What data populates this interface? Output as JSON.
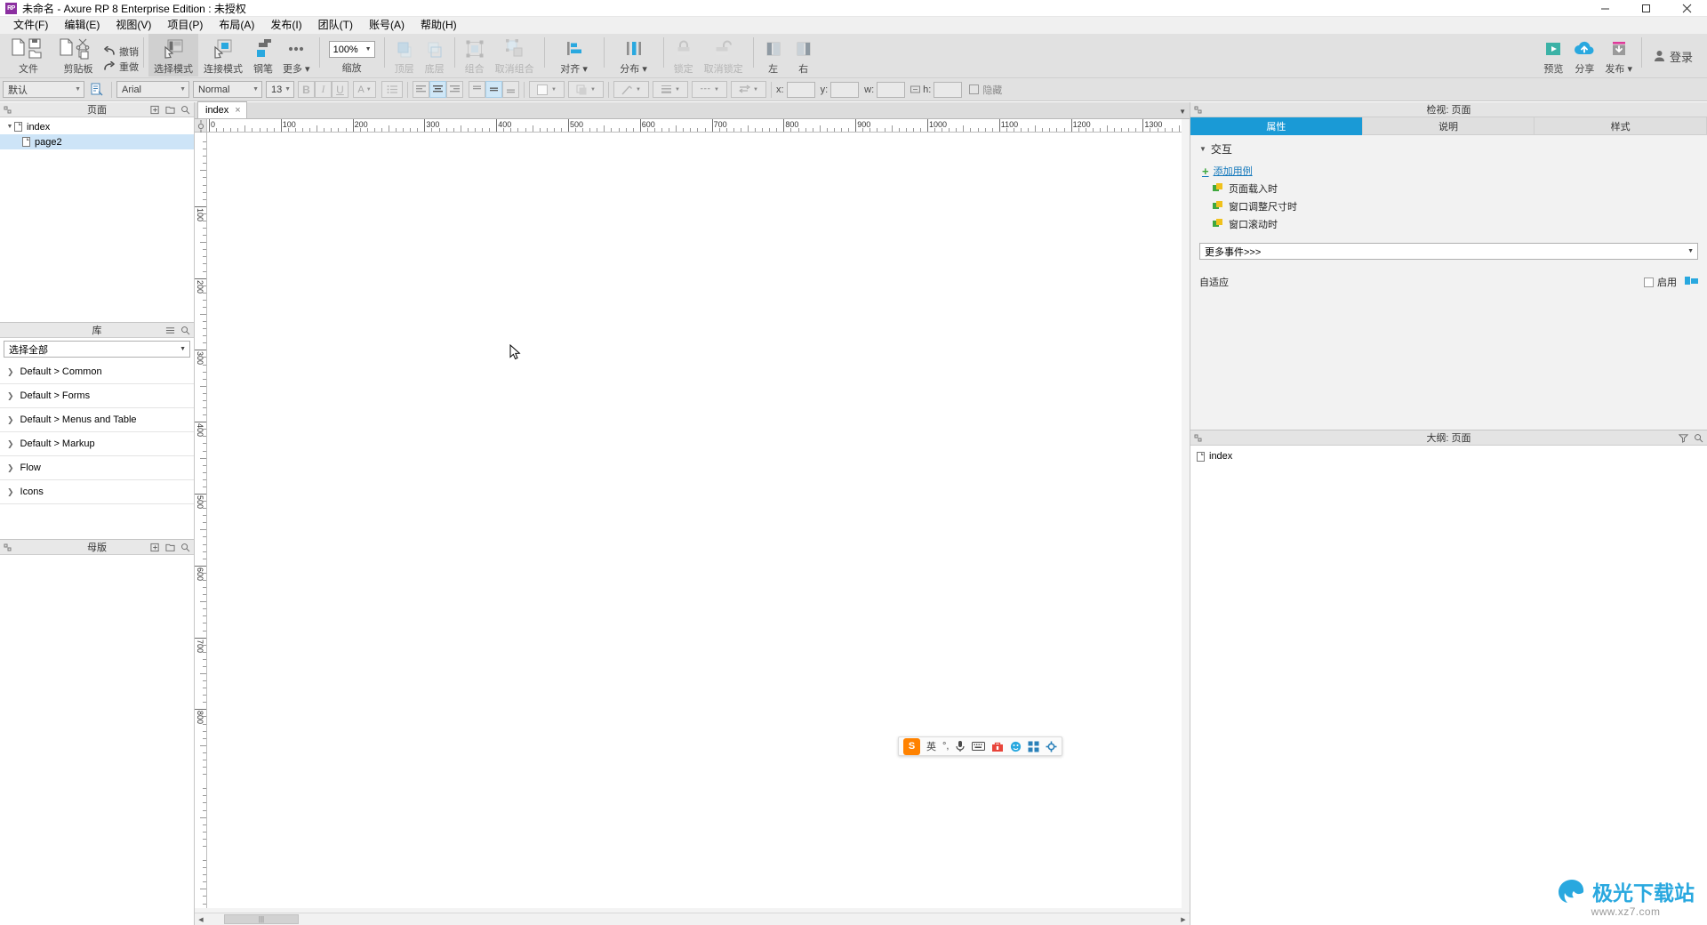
{
  "titlebar": {
    "app_badge": "RP",
    "title": "未命名 - Axure RP 8 Enterprise Edition : 未授权",
    "minimize": "minimize-icon",
    "maximize": "maximize-icon",
    "close": "close-icon"
  },
  "menubar": {
    "items": [
      {
        "label": "文件(F)",
        "name": "menu-file"
      },
      {
        "label": "编辑(E)",
        "name": "menu-edit"
      },
      {
        "label": "视图(V)",
        "name": "menu-view"
      },
      {
        "label": "项目(P)",
        "name": "menu-project"
      },
      {
        "label": "布局(A)",
        "name": "menu-layout"
      },
      {
        "label": "发布(I)",
        "name": "menu-publish"
      },
      {
        "label": "团队(T)",
        "name": "menu-team"
      },
      {
        "label": "账号(A)",
        "name": "menu-account"
      },
      {
        "label": "帮助(H)",
        "name": "menu-help"
      }
    ]
  },
  "toolbar": {
    "file_label": "文件",
    "clipboard_label": "剪贴板",
    "undo_label": "撤销",
    "redo_label": "重做",
    "select_mode_label": "选择模式",
    "connect_mode_label": "连接模式",
    "pen_label": "钢笔",
    "more_label": "更多",
    "zoom_value": "100%",
    "zoom_label": "缩放",
    "front_label": "顶层",
    "back_label": "底层",
    "group_label": "组合",
    "ungroup_label": "取消组合",
    "align_label": "对齐",
    "distribute_label": "分布",
    "lock_label": "锁定",
    "unlock_label": "取消锁定",
    "left_label": "左",
    "right_label": "右",
    "preview_label": "预览",
    "share_label": "分享",
    "publish_label": "发布",
    "signin_label": "登录"
  },
  "format": {
    "style_value": "默认",
    "font_value": "Arial",
    "weight_value": "Normal",
    "size_value": "13",
    "bold": "B",
    "italic": "I",
    "underline": "U",
    "font_color": "A",
    "bullets": "list-icon",
    "align_left": "align-left-icon",
    "align_center": "align-center-icon",
    "align_right": "align-right-icon",
    "valign_top": "valign-top-icon",
    "valign_middle": "valign-middle-icon",
    "valign_bottom": "valign-bottom-icon",
    "fill": "fill-icon",
    "shadow": "shadow-icon",
    "line": "line-icon",
    "line_style": "line-style-icon",
    "line_dash": "dash-icon",
    "arrow": "arrow-icon",
    "x_label": "x:",
    "y_label": "y:",
    "w_label": "w:",
    "h_label": "h:",
    "x_value": "",
    "y_value": "",
    "w_value": "",
    "h_value": "",
    "hidden_label": "隐藏"
  },
  "left": {
    "pages": {
      "title": "页面",
      "tree": [
        {
          "label": "index",
          "level": 0,
          "selected": false,
          "expandable": true
        },
        {
          "label": "page2",
          "level": 1,
          "selected": true,
          "expandable": false
        }
      ]
    },
    "library": {
      "title": "库",
      "select_value": "选择全部",
      "groups": [
        {
          "label": "Default > Common"
        },
        {
          "label": "Default > Forms"
        },
        {
          "label": "Default > Menus and Table"
        },
        {
          "label": "Default > Markup"
        },
        {
          "label": "Flow"
        },
        {
          "label": "Icons"
        }
      ]
    },
    "masters": {
      "title": "母版"
    }
  },
  "canvas": {
    "tab_label": "index",
    "tab_close": "×",
    "h_ruler_labels": [
      "0",
      "100",
      "200",
      "300",
      "400",
      "500",
      "600",
      "700",
      "800",
      "900",
      "1000",
      "1100",
      "1200",
      "1300"
    ],
    "v_ruler_labels": [
      "100",
      "200",
      "300",
      "400",
      "500",
      "600",
      "700",
      "800"
    ],
    "cursor": "mouse-pointer"
  },
  "ime": {
    "logo": "S",
    "lang": "英",
    "punct": "°,",
    "mic": "mic-icon",
    "keyboard": "keyboard-icon",
    "toolbox": "toolbox-icon",
    "emoji": "emoji-icon",
    "apps": "apps-icon",
    "settings": "settings-icon"
  },
  "right": {
    "inspector": {
      "title": "检视: 页面",
      "tabs": [
        {
          "label": "属性",
          "active": true
        },
        {
          "label": "说明",
          "active": false
        },
        {
          "label": "样式",
          "active": false
        }
      ],
      "interaction_section": "交互",
      "add_case": "添加用例",
      "events": [
        {
          "label": "页面载入时"
        },
        {
          "label": "窗口调整尺寸时"
        },
        {
          "label": "窗口滚动时"
        }
      ],
      "more_events": "更多事件>>>",
      "adaptive_label": "自适应",
      "enable_label": "启用",
      "manage_icon": "adaptive-manage-icon"
    },
    "outline": {
      "title": "大纲: 页面",
      "filter_icon": "filter-icon",
      "search_icon": "search-icon",
      "items": [
        {
          "label": "index"
        }
      ]
    }
  },
  "watermark": {
    "brand": "极光下载站",
    "url": "www.xz7.com"
  },
  "colors": {
    "accent": "#1a9ad6",
    "link": "#1177bb",
    "green": "#3fa83f",
    "toolbar_bg": "#e1e1e1",
    "selection": "#cde4f7"
  }
}
